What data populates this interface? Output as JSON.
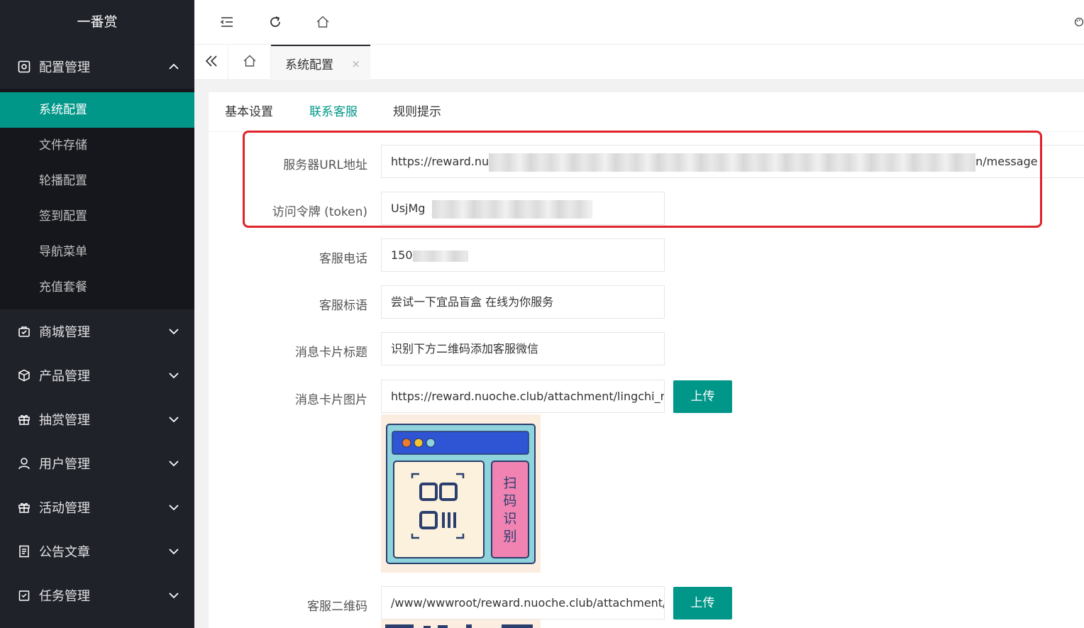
{
  "app": {
    "title": "一番赏"
  },
  "sidebar": {
    "groups": [
      {
        "label": "配置管理",
        "icon": "settings-icon",
        "expanded": true,
        "items": [
          {
            "label": "系统配置",
            "active": true
          },
          {
            "label": "文件存储"
          },
          {
            "label": "轮播配置"
          },
          {
            "label": "签到配置"
          },
          {
            "label": "导航菜单"
          },
          {
            "label": "充值套餐"
          }
        ]
      },
      {
        "label": "商城管理",
        "icon": "shop-bag-icon"
      },
      {
        "label": "产品管理",
        "icon": "box-icon"
      },
      {
        "label": "抽赏管理",
        "icon": "gift-icon"
      },
      {
        "label": "用户管理",
        "icon": "user-icon"
      },
      {
        "label": "活动管理",
        "icon": "gift-icon"
      },
      {
        "label": "公告文章",
        "icon": "document-icon"
      },
      {
        "label": "任务管理",
        "icon": "task-icon"
      }
    ]
  },
  "topbar": {
    "icons": [
      "menu-fold-icon",
      "refresh-icon",
      "home-icon",
      "theme-icon"
    ]
  },
  "tabs": {
    "page_tab": "系统配置",
    "close": "×"
  },
  "settings_tabs": [
    {
      "label": "基本设置"
    },
    {
      "label": "联系客服",
      "active": true
    },
    {
      "label": "规则提示"
    }
  ],
  "form": {
    "server_url": {
      "label": "服务器URL地址",
      "value_start": "https://reward.nu",
      "value_end": "n/message"
    },
    "token": {
      "label": "访问令牌 (token)",
      "value_start": "UsjMg"
    },
    "phone": {
      "label": "客服电话",
      "value_start": "150"
    },
    "slogan": {
      "label": "客服标语",
      "value": "尝试一下宜品盲盒 在线为你服务"
    },
    "card_title": {
      "label": "消息卡片标题",
      "value": "识别下方二维码添加客服微信"
    },
    "card_image": {
      "label": "消息卡片图片",
      "value": "https://reward.nuoche.club/attachment/lingchi_reward",
      "upload": "上传",
      "preview": {
        "side_text": [
          "扫",
          "码",
          "识",
          "别"
        ]
      }
    },
    "qr_code": {
      "label": "客服二维码",
      "value": "/www/wwwroot/reward.nuoche.club/attachment/lingchi",
      "upload": "上传"
    }
  },
  "colors": {
    "sidebar_bg": "#20222a",
    "accent": "#009688",
    "highlight": "#e0242b"
  }
}
